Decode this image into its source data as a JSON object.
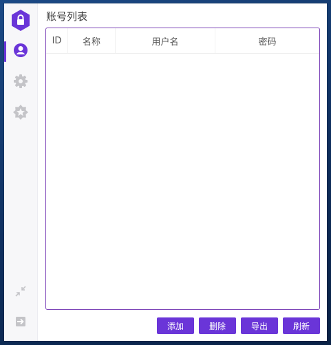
{
  "page": {
    "title": "账号列表"
  },
  "table": {
    "columns": [
      {
        "key": "id",
        "label": "ID"
      },
      {
        "key": "name",
        "label": "名称"
      },
      {
        "key": "username",
        "label": "用户名"
      },
      {
        "key": "password",
        "label": "密码"
      }
    ],
    "rows": []
  },
  "actions": {
    "add_label": "添加",
    "delete_label": "删除",
    "export_label": "导出",
    "refresh_label": "刷新"
  },
  "sidebar": {
    "logo_icon": "lock-hexagon-icon",
    "items": [
      {
        "icon": "user-icon",
        "active": true
      },
      {
        "icon": "gear-icon",
        "active": false
      },
      {
        "icon": "star-badge-icon",
        "active": false
      }
    ],
    "bottom": [
      {
        "icon": "collapse-icon"
      },
      {
        "icon": "logout-icon"
      }
    ]
  },
  "colors": {
    "accent": "#6a35d8",
    "table_border": "#7c44b8",
    "icon_inactive": "#c4c4c8"
  }
}
